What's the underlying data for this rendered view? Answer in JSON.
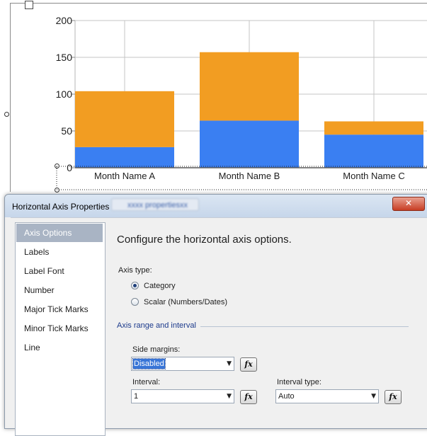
{
  "chart_data": {
    "type": "bar",
    "stacked": true,
    "categories": [
      "Month Name A",
      "Month Name B",
      "Month Name C"
    ],
    "series": [
      {
        "values": [
          28,
          64,
          45
        ],
        "color": "#3a7ff2"
      },
      {
        "values": [
          76,
          93,
          18
        ],
        "color": "#f29d22"
      }
    ],
    "yticks": [
      "200",
      "150",
      "100",
      "50",
      "0"
    ],
    "ylim": [
      0,
      200
    ],
    "grid": true
  },
  "dialog": {
    "title": "Horizontal Axis Properties",
    "subtitle_blurred": "xxxx propertiesxx",
    "close_glyph": "✕"
  },
  "sidebar": {
    "items": [
      {
        "label": "Axis Options"
      },
      {
        "label": "Labels"
      },
      {
        "label": "Label Font"
      },
      {
        "label": "Number"
      },
      {
        "label": "Major Tick Marks"
      },
      {
        "label": "Minor Tick Marks"
      },
      {
        "label": "Line"
      }
    ]
  },
  "content": {
    "heading": "Configure the horizontal axis options.",
    "axis_type_label": "Axis type:",
    "axis_type_options": [
      "Category",
      "Scalar (Numbers/Dates)"
    ],
    "axis_type_selected": "Category",
    "section_title": "Axis range and interval",
    "side_margins": {
      "label": "Side margins:",
      "value": "Disabled"
    },
    "interval": {
      "label": "Interval:",
      "value": "1"
    },
    "interval_type": {
      "label": "Interval type:",
      "value": "Auto"
    },
    "fx_label": "fx",
    "dropdown_glyph": "▼"
  },
  "colors": {
    "accent_selected": "#3875d7",
    "section_title": "#1c3a8c",
    "close_button": "#c73d24"
  }
}
